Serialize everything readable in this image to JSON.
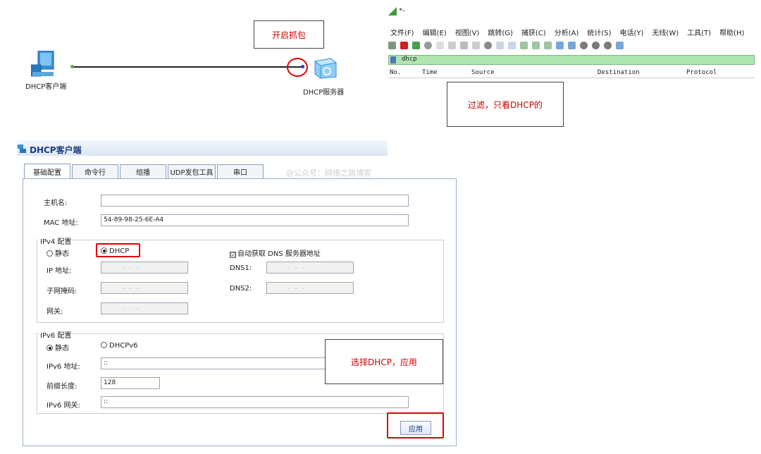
{
  "topology": {
    "client_label": "DHCP客户端",
    "server_label": "DHCP服务器",
    "callout_capture": "开启抓包"
  },
  "wireshark": {
    "title": "*-",
    "menu": [
      "文件(F)",
      "编辑(E)",
      "视图(V)",
      "跳转(G)",
      "捕获(C)",
      "分析(A)",
      "统计(S)",
      "电话(Y)",
      "无线(W)",
      "工具(T)",
      "帮助(H)"
    ],
    "filter": "dhcp",
    "columns": [
      "No.",
      "Time",
      "Source",
      "Destination",
      "Protocol"
    ],
    "callout_filter": "过滤，只看DHCP的",
    "accent_color": "#afe6af"
  },
  "dialog": {
    "title": "DHCP客户端",
    "tabs": [
      "基础配置",
      "命令行",
      "组播",
      "UDP发包工具",
      "串口"
    ],
    "watermark": "@公众号：网络之路博客",
    "hostname_label": "主机名:",
    "hostname_value": "",
    "mac_label": "MAC 地址:",
    "mac_value": "54-89-98-25-6E-A4",
    "ipv4": {
      "group_label": "IPv4 配置",
      "static_label": "静态",
      "dhcp_label": "DHCP",
      "selected": "DHCP",
      "auto_dns_label": "自动获取 DNS 服务器地址",
      "auto_dns_checked": "☑",
      "ip_label": "IP 地址:",
      "mask_label": "子网掩码:",
      "gw_label": "网关:",
      "dns1_label": "DNS1:",
      "dns2_label": "DNS2:",
      "ip_placeholder": ".   .   ."
    },
    "ipv6": {
      "group_label": "IPv6 配置",
      "static_label": "静态",
      "dhcp_label": "DHCPv6",
      "selected": "静态",
      "addr_label": "IPv6 地址:",
      "addr_value": "::",
      "prefix_label": "前缀长度:",
      "prefix_value": "128",
      "gw_label": "IPv6 网关:",
      "gw_value": "::"
    },
    "callout_apply": "选择DHCP，应用",
    "apply_label": "应用"
  }
}
